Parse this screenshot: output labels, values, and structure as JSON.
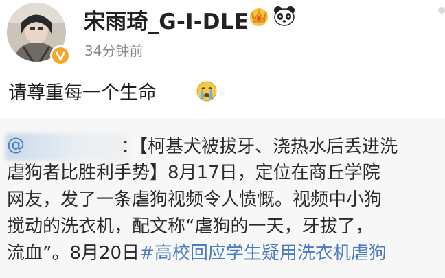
{
  "post": {
    "username": "宋雨琦_G-I-DLE",
    "timestamp": "34分钟前",
    "text": "请尊重每一个生命",
    "badges": [
      "crown-badge-icon",
      "panda-badge-icon",
      "verified-v-icon",
      "crying-face-emoji"
    ]
  },
  "repost": {
    "mention_at": "@",
    "lines": {
      "l1": "：【柯基犬被拔牙、浇热水后丢进洗",
      "l2": "虐狗者比胜利手势】8月17日，定位在商丘学院",
      "l3": "网友，发了一条虐狗视频令人愤慨。视频中小狗",
      "l4": "搅动的洗衣机，配文称“虐狗的一天，牙拔了，",
      "l5_prefix": "流血”。8月20日",
      "l5_hashtag": "#高校回应学生疑用洗衣机虐狗"
    }
  },
  "colors": {
    "link_blue": "#4a7cbf",
    "timestamp_gray": "#8a8a8a",
    "verified_orange": "#f5a623",
    "repost_bg": "#f7f7f7"
  }
}
